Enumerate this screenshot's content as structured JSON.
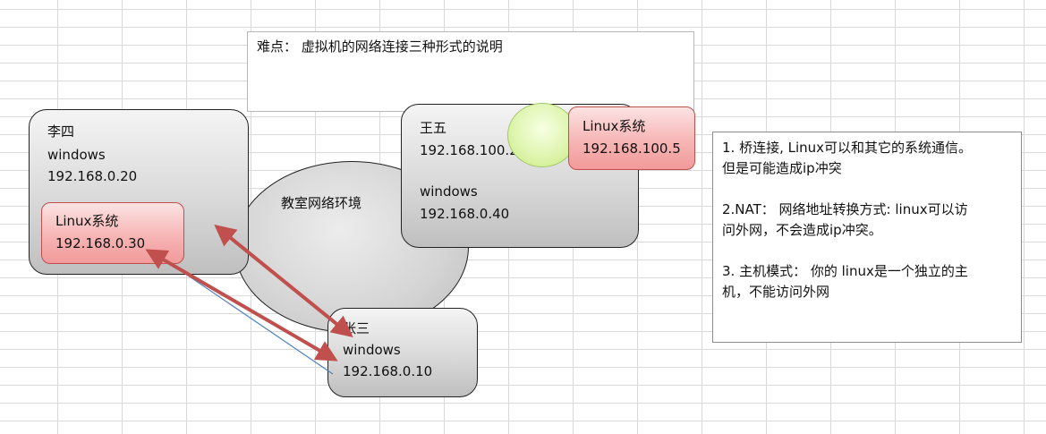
{
  "title_box": {
    "text": "难点： 虚拟机的网络连接三种形式的说明"
  },
  "lisi": {
    "name": "李四",
    "os": "windows",
    "ip": "192.168.0.20",
    "vm": {
      "name": "Linux系统",
      "ip": "192.168.0.30"
    }
  },
  "wangwu": {
    "name": "王五",
    "ip": "192.168.100.2",
    "os": "windows",
    "os_ip": "192.168.0.40",
    "vm": {
      "name": "Linux系统",
      "ip": "192.168.100.5"
    }
  },
  "zhangsan": {
    "name": "张三",
    "os": "windows",
    "ip": "192.168.0.10"
  },
  "cloud": {
    "label": "教室网络环境"
  },
  "notes": {
    "bridge": [
      "1. 桥连接, Linux可以和其它的系统通信。",
      "但是可能造成ip冲突"
    ],
    "nat": [
      "2.NAT： 网络地址转换方式: linux可以访",
      "问外网，不会造成ip冲突。"
    ],
    "host": [
      "3. 主机模式： 你的 linux是一个独立的主",
      "机，不能访问外网"
    ]
  },
  "colors": {
    "arrow": "#c0504d",
    "thin_line": "#4f81bd",
    "vm_box": "#f7b5b5",
    "host_box": "#d9d9d9",
    "circle": "#dff5b0"
  }
}
